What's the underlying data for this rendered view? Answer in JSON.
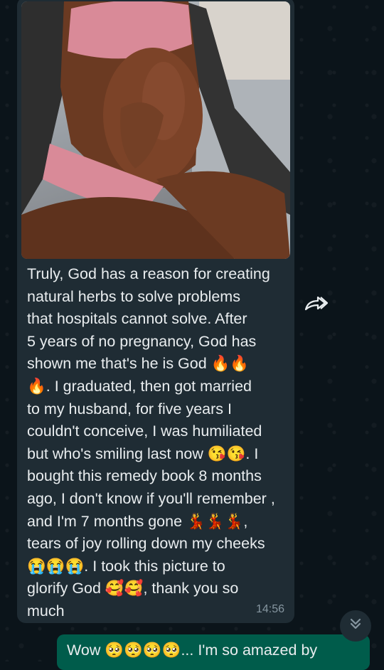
{
  "message": {
    "text": "Truly, God has a reason for creating\nnatural herbs to solve problems\nthat hospitals cannot solve. After\n5 years of no pregnancy, God has\nshown me that's he is God 🔥🔥\n🔥. I graduated, then got married\nto my husband, for five years I\ncouldn't conceive, I was humiliated\nbut who's smiling last now 😘😘. I\nbought this remedy book 8 months\nago, I don't know if you'll remember ,\nand I'm 7 months gone 💃💃💃,\ntears of joy rolling down my cheeks\n😭😭😭. I took this picture to\nglorify God 🥰🥰, thank you so\nmuch",
    "time": "14:56"
  },
  "outgoing": {
    "text": "Wow 🥺🥺🥺🥺... I'm so amazed by"
  },
  "icons": {
    "forward": "forward-icon",
    "scroll_down": "chevron-double-down-icon"
  },
  "colors": {
    "background": "#0b141a",
    "incoming_bubble": "#1f2c34",
    "outgoing_bubble": "#005c4b",
    "text": "#e9edef",
    "meta": "#8696a0"
  }
}
